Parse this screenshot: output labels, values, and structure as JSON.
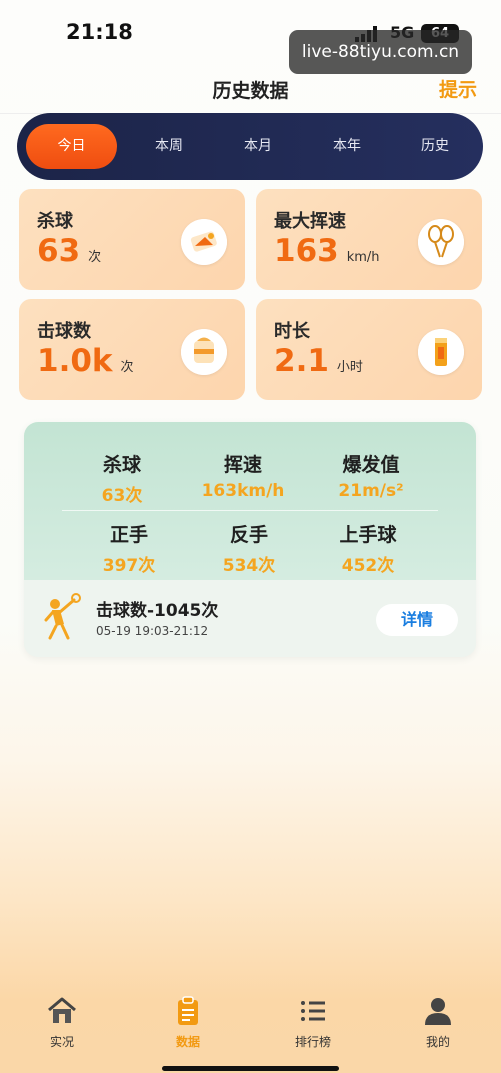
{
  "status_bar": {
    "time": "21:18",
    "network": "5G",
    "battery": "64"
  },
  "watermark": "live-88tiyu.com.cn",
  "header": {
    "title": "历史数据",
    "hint": "提示"
  },
  "tabs": [
    {
      "label": "今日",
      "active": true
    },
    {
      "label": "本周",
      "active": false
    },
    {
      "label": "本月",
      "active": false
    },
    {
      "label": "本年",
      "active": false
    },
    {
      "label": "历史",
      "active": false
    }
  ],
  "stats": [
    {
      "label": "杀球",
      "value": "63",
      "unit": "次",
      "icon": "smash-icon"
    },
    {
      "label": "最大挥速",
      "value": "163",
      "unit": "km/h",
      "icon": "racket-icon"
    },
    {
      "label": "击球数",
      "value": "1.0k",
      "unit": "次",
      "icon": "shuttle-count-icon"
    },
    {
      "label": "时长",
      "value": "2.1",
      "unit": "小时",
      "icon": "duration-icon"
    }
  ],
  "summary": {
    "metrics": [
      {
        "label": "杀球",
        "value": "63次"
      },
      {
        "label": "挥速",
        "value": "163km/h"
      },
      {
        "label": "爆发值",
        "value": "21m/s²"
      },
      {
        "label": "正手",
        "value": "397次"
      },
      {
        "label": "反手",
        "value": "534次"
      },
      {
        "label": "上手球",
        "value": "452次"
      }
    ],
    "session": {
      "title": "击球数-1045次",
      "time": "05-19 19:03-21:12",
      "details_label": "详情"
    }
  },
  "bottom_nav": [
    {
      "label": "实况",
      "icon": "home-icon",
      "active": false
    },
    {
      "label": "数据",
      "icon": "clipboard-icon",
      "active": true
    },
    {
      "label": "排行榜",
      "icon": "list-icon",
      "active": false
    },
    {
      "label": "我的",
      "icon": "user-icon",
      "active": false
    }
  ],
  "colors": {
    "accent": "#f29a12",
    "highlight": "#f06a12",
    "tab_bar": "#1c2448",
    "link": "#1a7ee0"
  }
}
